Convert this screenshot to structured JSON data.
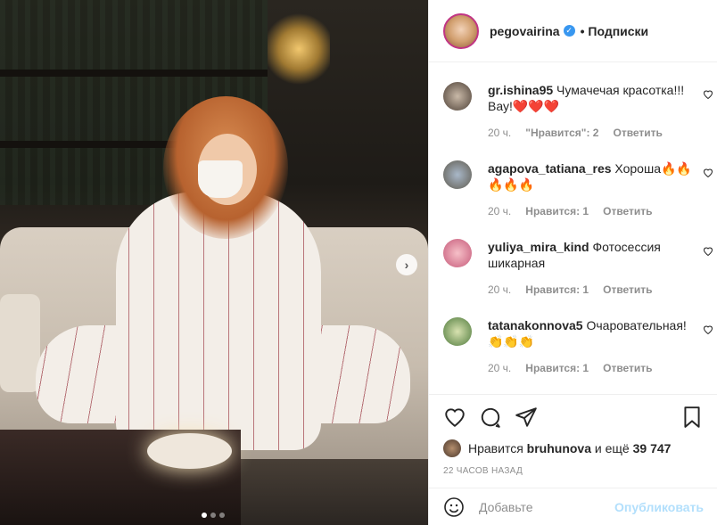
{
  "post": {
    "username": "pegovairina",
    "follow_label": "• Подписки"
  },
  "comments": [
    {
      "author": "gr.ishina95",
      "text": "Чумачечая красотка!!! Вау!❤️❤️❤️",
      "time": "20 ч.",
      "likes": "\"Нравится\": 2",
      "reply": "Ответить"
    },
    {
      "author": "agapova_tatiana_res",
      "text": "Хороша🔥🔥🔥🔥🔥",
      "time": "20 ч.",
      "likes": "Нравится: 1",
      "reply": "Ответить"
    },
    {
      "author": "yuliya_mira_kind",
      "text": "Фотосессия шикарная",
      "time": "20 ч.",
      "likes": "Нравится: 1",
      "reply": "Ответить"
    },
    {
      "author": "tatanakonnova5",
      "text": "Очаровательная! 👏👏👏",
      "time": "20 ч.",
      "likes": "Нравится: 1",
      "reply": "Ответить"
    }
  ],
  "likes": {
    "prefix": "Нравится",
    "user": "bruhunova",
    "middle": "и ещё",
    "count": "39 747"
  },
  "timestamp": "22 ЧАСОВ НАЗАД",
  "add_comment": {
    "placeholder": "Добавьте",
    "publish": "Опубликовать"
  },
  "carousel": {
    "dots": 3,
    "active": 1
  }
}
